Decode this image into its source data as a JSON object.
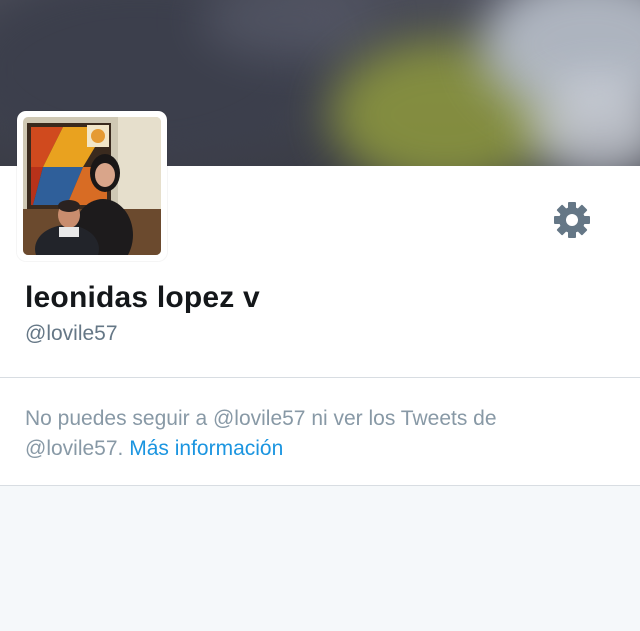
{
  "profile": {
    "display_name": "leonidas lopez v",
    "handle": "@lovile57"
  },
  "protected_notice": {
    "text_line1": "No puedes seguir a @lovile57 ni ver los Tweets de",
    "text_line2_prefix": "@lovile57.",
    "link_label": "Más información"
  },
  "icons": {
    "settings": "gear-icon"
  },
  "colors": {
    "link": "#1b95e0",
    "secondary_text": "#657786",
    "muted_text": "#8899a6",
    "gear": "#657786",
    "name_text": "#14171a"
  }
}
